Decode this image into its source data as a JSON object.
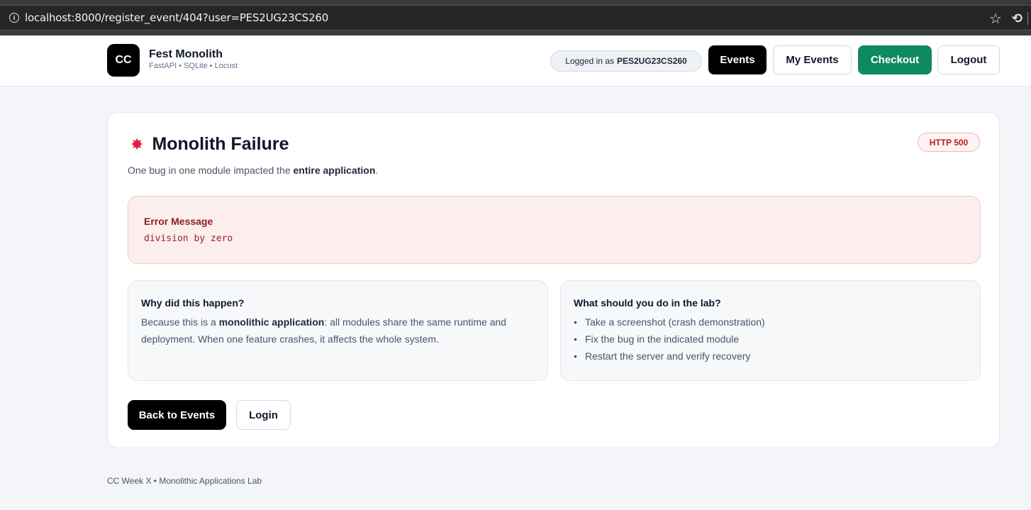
{
  "browser": {
    "url": "localhost:8000/register_event/404?user=PES2UG23CS260",
    "info_icon": "info-icon",
    "bookmark_icon": "star-icon",
    "extension_icon": "extension-icon"
  },
  "header": {
    "logo_text": "CC",
    "brand_name": "Fest Monolith",
    "brand_sub": "FastAPI • SQLite • Locust",
    "logged_in_prefix": "Logged in as",
    "username": "PES2UG23CS260",
    "nav": {
      "events": "Events",
      "my_events": "My Events",
      "checkout": "Checkout",
      "logout": "Logout"
    }
  },
  "card": {
    "icon": "burst-icon",
    "title": "Monolith Failure",
    "subtitle_pre": "One bug in one module impacted the ",
    "subtitle_bold": "entire application",
    "subtitle_post": ".",
    "badge": "HTTP 500",
    "error": {
      "label": "Error Message",
      "message": "division by zero"
    },
    "why": {
      "title": "Why did this happen?",
      "text_pre": "Because this is a ",
      "text_bold": "monolithic application",
      "text_post": ": all modules share the same runtime and deployment. When one feature crashes, it affects the whole system."
    },
    "todo": {
      "title": "What should you do in the lab?",
      "items": [
        "Take a screenshot (crash demonstration)",
        "Fix the bug in the indicated module",
        "Restart the server and verify recovery"
      ]
    },
    "actions": {
      "back": "Back to Events",
      "login": "Login"
    }
  },
  "footer": {
    "text": "CC Week X • Monolithic Applications Lab"
  },
  "colors": {
    "checkout": "#0f8a5f",
    "error_bg": "#fdeeee",
    "error_text": "#8b1c1c",
    "primary": "#000000"
  }
}
